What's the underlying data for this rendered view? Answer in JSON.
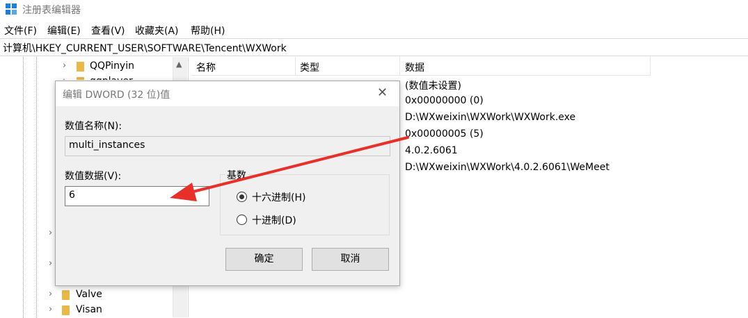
{
  "window": {
    "title": "注册表编辑器"
  },
  "menu": [
    "文件(F)",
    "编辑(E)",
    "查看(V)",
    "收藏夹(A)",
    "帮助(H)"
  ],
  "address": "计算机\\HKEY_CURRENT_USER\\SOFTWARE\\Tencent\\WXWork",
  "tree": {
    "items": [
      {
        "label": "QQPinyin"
      },
      {
        "label": "qqplayer"
      },
      {
        "label": "Valve"
      },
      {
        "label": "Visan"
      }
    ]
  },
  "list": {
    "headers": {
      "name": "名称",
      "type": "类型",
      "data": "数据"
    },
    "rows": [
      {
        "data": "(数值未设置)"
      },
      {
        "data": "0x00000000 (0)"
      },
      {
        "data": "D:\\WXweixin\\WXWork\\WXWork.exe"
      },
      {
        "data": "0x00000005 (5)"
      },
      {
        "data": "4.0.2.6061"
      },
      {
        "data": "D:\\WXweixin\\WXWork\\4.0.2.6061\\WeMeet"
      }
    ]
  },
  "dialog": {
    "title": "编辑 DWORD (32 位)值",
    "name_label": "数值名称(N):",
    "name_value": "multi_instances",
    "data_label": "数值数据(V):",
    "data_value": "6",
    "base_label": "基数",
    "hex_label": "十六进制(H)",
    "dec_label": "十进制(D)",
    "selected_base": "hex",
    "ok": "确定",
    "cancel": "取消"
  },
  "colors": {
    "arrow": "#e8302b",
    "folder": "#e8b84a",
    "app_icon": "#1e7fd8"
  },
  "icons": {
    "app": "registry-icon",
    "close": "close-icon",
    "chevron": "chevron-right-icon",
    "folder": "folder-icon"
  }
}
